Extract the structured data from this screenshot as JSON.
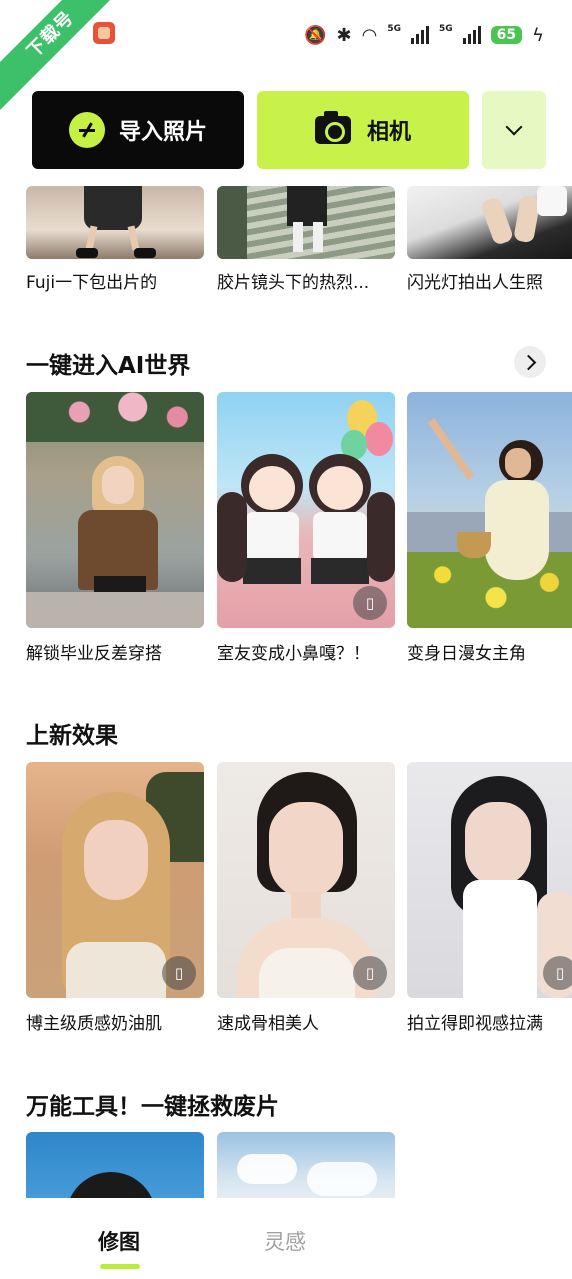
{
  "status": {
    "watermark": "下载号",
    "network_1": "5G",
    "network_2": "5G",
    "battery": "65"
  },
  "actions": {
    "import_label": "导入照片",
    "camera_label": "相机"
  },
  "top_row": [
    {
      "caption": "Fuji一下包出片的"
    },
    {
      "caption": "胶片镜头下的热烈..."
    },
    {
      "caption": "闪光灯拍出人生照"
    }
  ],
  "sections": [
    {
      "title": "一键进入AI世界",
      "items": [
        {
          "caption": "解锁毕业反差穿搭"
        },
        {
          "caption": "室友变成小鼻嘎？！"
        },
        {
          "caption": "变身日漫女主角"
        }
      ]
    },
    {
      "title": "上新效果",
      "items": [
        {
          "caption": "博主级质感奶油肌"
        },
        {
          "caption": "速成骨相美人"
        },
        {
          "caption": "拍立得即视感拉满"
        }
      ]
    },
    {
      "title": "万能工具！一键拯救废片",
      "items": []
    }
  ],
  "nav": {
    "tab_edit": "修图",
    "tab_inspire": "灵感"
  },
  "colors": {
    "accent_lime": "#c8f24a",
    "dark": "#0a0a0a"
  }
}
